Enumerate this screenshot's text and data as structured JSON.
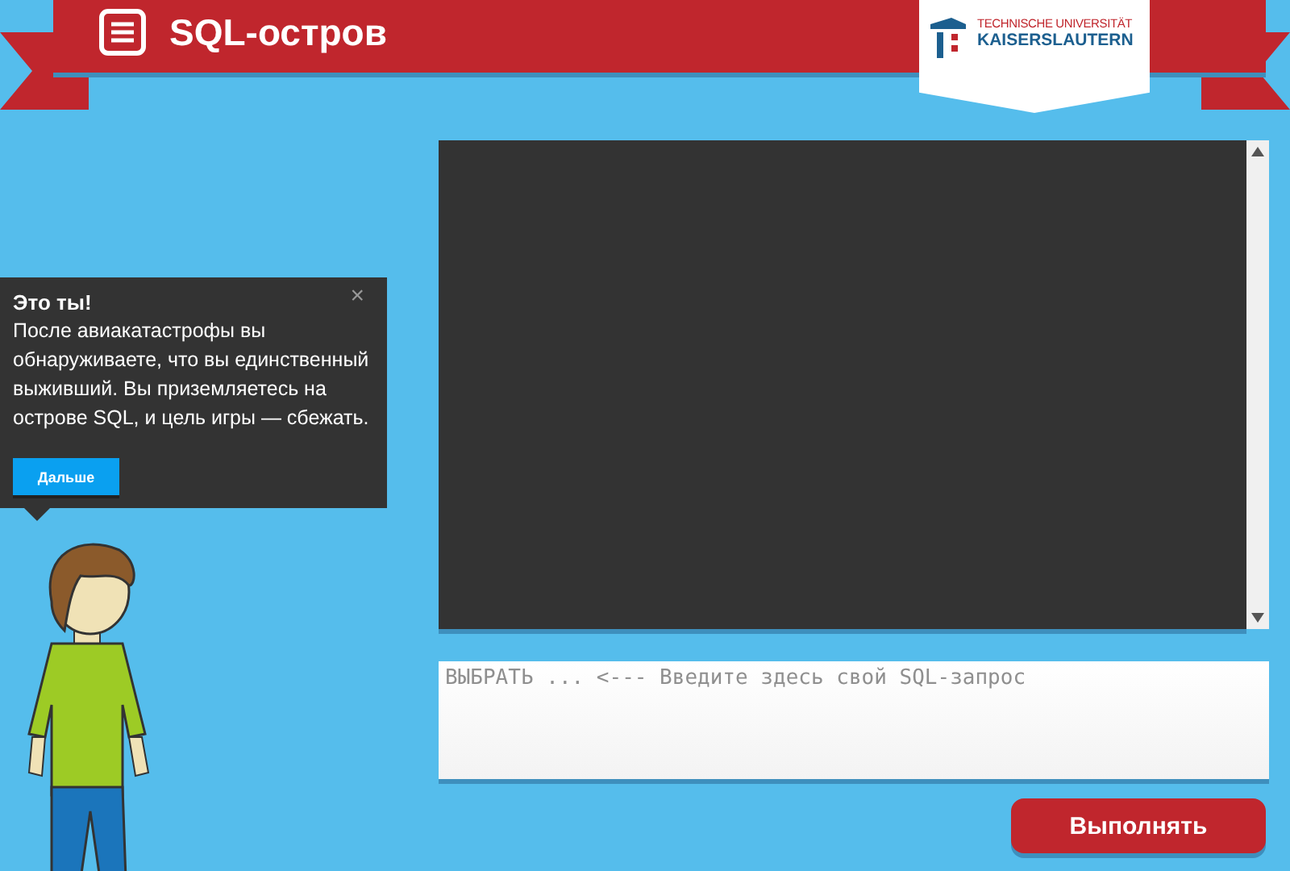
{
  "header": {
    "title": "SQL-остров",
    "logo_lines": [
      "TECHNISCHE UNIVERSITÄT",
      "KAISERSLAUTERN"
    ]
  },
  "tooltip": {
    "title": "Это ты!",
    "text": "После авиакатастрофы вы обнаруживаете, что вы единственный выживший. Вы приземляетесь на острове SQL, и цель игры — сбежать.",
    "close": "×",
    "button": "Дальше"
  },
  "query": {
    "placeholder": "ВЫБРАТЬ ... <--- Введите здесь свой SQL-запрос"
  },
  "run_button": "Выполнять"
}
